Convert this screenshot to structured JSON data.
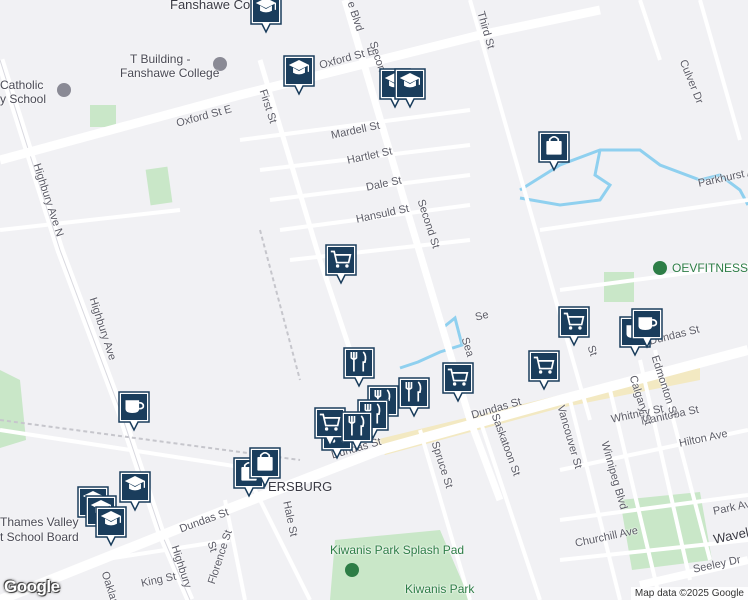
{
  "map": {
    "attribution": "Map data ©2025 Google",
    "logo": "Google",
    "place_labels": [
      {
        "text": "Fanshawe College",
        "cls": "big"
      },
      {
        "text": "T Building -",
        "cls": "poi"
      },
      {
        "text": "Fanshawe College",
        "cls": "poi"
      },
      {
        "text": "Catholic",
        "cls": "poi"
      },
      {
        "text": "y School",
        "cls": "poi"
      },
      {
        "text": "OEVFITNESS",
        "cls": "green"
      },
      {
        "text": "ERSBURG",
        "cls": "big"
      },
      {
        "text": "Thames Valley",
        "cls": "poi"
      },
      {
        "text": "t School Board",
        "cls": "poi"
      },
      {
        "text": "Kiwanis Park Splash Pad",
        "cls": "green"
      },
      {
        "text": "Kiwanis Park",
        "cls": "green"
      }
    ],
    "street_labels": [
      "Oxford St E",
      "Oxford St E",
      "e Blvd",
      "Second St",
      "Third St",
      "First St",
      "Mardell St",
      "Hartlet St",
      "Dale St",
      "Hansuld St",
      "Second St",
      "Highbury Ave N",
      "Highbury Ave",
      "Parkhurst Av",
      "Culver Dr",
      "Dundas St",
      "Dundas St",
      "Dundas St",
      "Dundas St",
      "Saskatoon St",
      "Spruce St",
      "Vancouver St",
      "Whitney St",
      "Winnipeg Blvd",
      "Manitoba St",
      "Calgary St",
      "Edmonton St",
      "Hilton Ave",
      "Churchill Ave",
      "Park Ave",
      "Wavell",
      "Seeley Dr",
      "King St",
      "Florence St",
      "Hale St",
      "Oaklan",
      "Highbury",
      "St",
      "St",
      "Sea",
      "Se"
    ]
  },
  "markers": [
    {
      "icon": "school-icon"
    },
    {
      "icon": "school-icon"
    },
    {
      "icon": "school-icon"
    },
    {
      "icon": "school-icon"
    },
    {
      "icon": "school-icon"
    },
    {
      "icon": "school-icon"
    },
    {
      "icon": "school-icon"
    },
    {
      "icon": "school-icon"
    },
    {
      "icon": "shopping-bag-icon"
    },
    {
      "icon": "shopping-bag-icon"
    },
    {
      "icon": "shopping-bag-icon"
    },
    {
      "icon": "shopping-cart-icon"
    },
    {
      "icon": "shopping-cart-icon"
    },
    {
      "icon": "shopping-cart-icon"
    },
    {
      "icon": "shopping-cart-icon"
    },
    {
      "icon": "shopping-cart-icon"
    },
    {
      "icon": "shopping-cart-icon"
    },
    {
      "icon": "restaurant-icon"
    },
    {
      "icon": "restaurant-icon"
    },
    {
      "icon": "restaurant-icon"
    },
    {
      "icon": "restaurant-icon"
    },
    {
      "icon": "restaurant-icon"
    },
    {
      "icon": "cafe-icon"
    },
    {
      "icon": "cafe-icon"
    },
    {
      "icon": "cafe-icon"
    }
  ]
}
